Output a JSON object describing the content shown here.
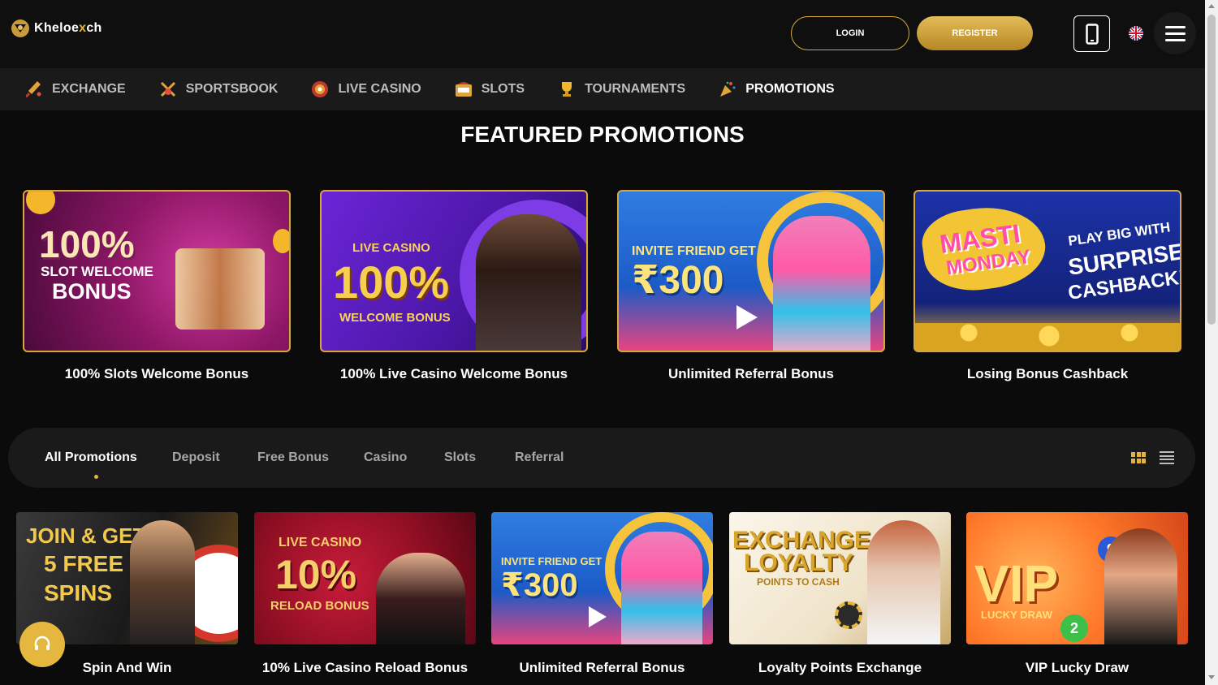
{
  "header": {
    "logo_text_a": "Kheloe",
    "logo_text_b": "x",
    "logo_text_c": "ch",
    "login_label": "LOGIN",
    "register_label": "REGISTER",
    "language_flag": "uk-flag-icon",
    "accent_color": "#d8a73c"
  },
  "nav": {
    "items": [
      {
        "label": "EXCHANGE",
        "icon": "cricket-bat-icon"
      },
      {
        "label": "SPORTSBOOK",
        "icon": "sports-icon"
      },
      {
        "label": "LIVE CASINO",
        "icon": "roulette-icon"
      },
      {
        "label": "SLOTS",
        "icon": "slot-machine-icon"
      },
      {
        "label": "TOURNAMENTS",
        "icon": "trophy-icon"
      },
      {
        "label": "PROMOTIONS",
        "icon": "party-popper-icon"
      }
    ],
    "active": "PROMOTIONS"
  },
  "featured": {
    "title": "FEATURED PROMOTIONS",
    "cards": [
      {
        "caption": "100% Slots Welcome Bonus",
        "banner_lines": [
          "100%",
          "SLOT WELCOME",
          "BONUS"
        ]
      },
      {
        "caption": "100% Live Casino Welcome Bonus",
        "banner_lines": [
          "LIVE CASINO",
          "100%",
          "WELCOME BONUS"
        ]
      },
      {
        "caption": "Unlimited Referral Bonus",
        "banner_lines": [
          "INVITE FRIEND GET",
          "₹300"
        ]
      },
      {
        "caption": "Losing Bonus Cashback",
        "banner_lines": [
          "MASTI",
          "MONDAY",
          "PLAY BIG WITH",
          "SURPRISE",
          "CASHBACK!"
        ]
      }
    ]
  },
  "filters": {
    "tabs": [
      "All Promotions",
      "Deposit",
      "Free Bonus",
      "Casino",
      "Slots",
      "Referral"
    ],
    "active": "All Promotions"
  },
  "promos": [
    {
      "caption": "Spin And Win",
      "banner_lines": [
        "JOIN & GET",
        "5 FREE",
        "SPINS"
      ]
    },
    {
      "caption": "10% Live Casino Reload Bonus",
      "banner_lines": [
        "LIVE CASINO",
        "10%",
        "RELOAD BONUS"
      ]
    },
    {
      "caption": "Unlimited Referral Bonus",
      "banner_lines": [
        "INVITE FRIEND GET",
        "₹300"
      ]
    },
    {
      "caption": "Loyalty Points Exchange",
      "banner_lines": [
        "EXCHANGE",
        "LOYALTY",
        "POINTS TO CASH"
      ]
    },
    {
      "caption": "VIP Lucky Draw",
      "banner_lines": [
        "VIP",
        "LUCKY DRAW"
      ]
    }
  ]
}
